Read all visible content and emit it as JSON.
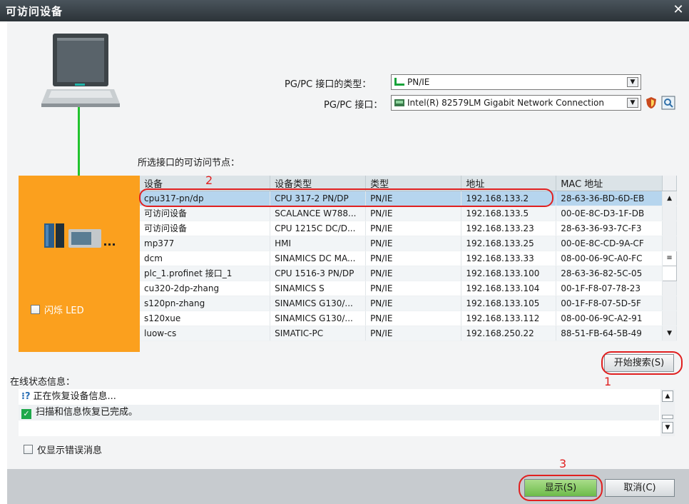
{
  "window": {
    "title": "可访问设备",
    "close_glyph": "✕"
  },
  "interface": {
    "type_label": "PG/PC 接口的类型：",
    "type_value": "PN/IE",
    "if_label": "PG/PC 接口：",
    "if_value": "Intel(R) 82579LM Gigabit Network Connection"
  },
  "nodes_label": "所选接口的可访问节点：",
  "table": {
    "headers": [
      "设备",
      "设备类型",
      "类型",
      "地址",
      "MAC 地址"
    ],
    "rows": [
      [
        "cpu317-pn/dp",
        "CPU 317-2 PN/DP",
        "PN/IE",
        "192.168.133.2",
        "28-63-36-BD-6D-EB"
      ],
      [
        "可访问设备",
        "SCALANCE W788...",
        "PN/IE",
        "192.168.133.5",
        "00-0E-8C-D3-1F-DB"
      ],
      [
        "可访问设备",
        "CPU 1215C DC/D...",
        "PN/IE",
        "192.168.133.23",
        "28-63-36-93-7C-F3"
      ],
      [
        "mp377",
        "HMI",
        "PN/IE",
        "192.168.133.25",
        "00-0E-8C-CD-9A-CF"
      ],
      [
        "dcm",
        "SINAMICS DC MA...",
        "PN/IE",
        "192.168.133.33",
        "08-00-06-9C-A0-FC"
      ],
      [
        "plc_1.profinet 接口_1",
        "CPU 1516-3 PN/DP",
        "PN/IE",
        "192.168.133.100",
        "28-63-36-82-5C-05"
      ],
      [
        "cu320-2dp-zhang",
        "SINAMICS S",
        "PN/IE",
        "192.168.133.104",
        "00-1F-F8-07-78-23"
      ],
      [
        "s120pn-zhang",
        "SINAMICS G130/...",
        "PN/IE",
        "192.168.133.105",
        "00-1F-F8-07-5D-5F"
      ],
      [
        "s120xue",
        "SINAMICS G130/...",
        "PN/IE",
        "192.168.133.112",
        "08-00-06-9C-A2-91"
      ],
      [
        "luow-cs",
        "SIMATIC-PC",
        "PN/IE",
        "192.168.250.22",
        "88-51-FB-64-5B-49"
      ]
    ]
  },
  "flash_led_label": "闪烁 LED",
  "search_button": "开始搜索(S)",
  "status": {
    "label": "在线状态信息：",
    "messages": [
      "正在恢复设备信息...",
      "扫描和信息恢复已完成。"
    ]
  },
  "only_errors_label": "仅显示错误消息",
  "buttons": {
    "show": "显示(S)",
    "cancel": "取消(C)"
  },
  "annotations": {
    "n1": "1",
    "n2": "2",
    "n3": "3"
  },
  "colors": {
    "accent_orange": "#fba01e",
    "selection": "#b6d5ee",
    "annotation_red": "#e02020",
    "link_green": "#22c32e"
  },
  "icons": [
    "laptop-icon",
    "network-icon",
    "nic-icon",
    "shield-icon",
    "properties-icon",
    "device-station-icon",
    "info-icon",
    "check-icon"
  ]
}
